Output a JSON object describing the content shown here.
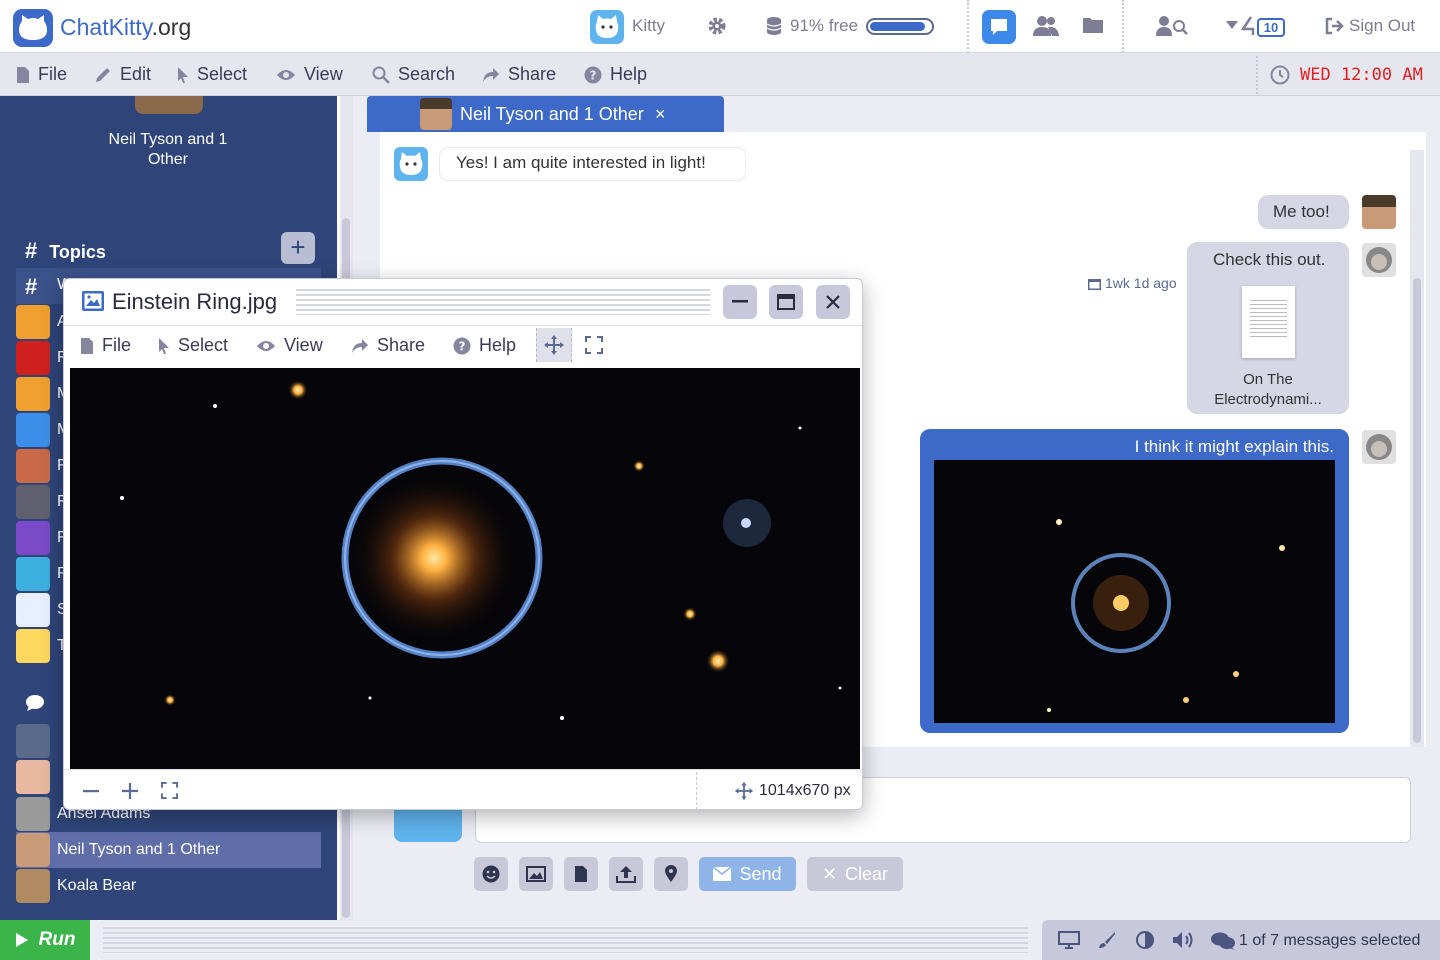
{
  "brand": {
    "name_blue": "ChatKitty",
    "name_tld": ".org"
  },
  "topbar": {
    "user": "Kitty",
    "storage_label": "91% free",
    "storage_fraction": 0.91,
    "notifications": "10",
    "sign_out": "Sign Out"
  },
  "menu": {
    "file": "File",
    "edit": "Edit",
    "select": "Select",
    "view": "View",
    "search": "Search",
    "share": "Share",
    "help": "Help"
  },
  "clock": "WED 12:00 AM",
  "sidebar": {
    "active_name": "Neil Tyson and 1 Other",
    "topics_label": "Topics",
    "topic_letters": [
      "W",
      "A",
      "F",
      "M",
      "M",
      "F",
      "F",
      "F",
      "R",
      "S",
      "T"
    ],
    "people": [
      "Ansel Adams",
      "Neil Tyson and 1 Other",
      "Koala Bear"
    ]
  },
  "tab": {
    "label": "Neil Tyson and 1 Other"
  },
  "messages": {
    "m1": "Yes!  I am quite interested in light!",
    "m2": "Me too!",
    "m3": "Check this out.",
    "m3_time": "1wk 1d ago",
    "m3_file": "On The Electrodynami...",
    "m4": "I think it might explain this."
  },
  "composer": {
    "send": "Send",
    "clear": "Clear"
  },
  "bottom": {
    "run": "Run",
    "status": "1 of 7 messages selected"
  },
  "viewer": {
    "title": "Einstein Ring.jpg",
    "menu": {
      "file": "File",
      "select": "Select",
      "view": "View",
      "share": "Share",
      "help": "Help"
    },
    "dimensions": "1014x670 px"
  },
  "colors": {
    "brand_blue": "#3d69c8",
    "sidebar": "#2f4579",
    "run_green": "#3bb54a",
    "clock_red": "#e02020"
  }
}
